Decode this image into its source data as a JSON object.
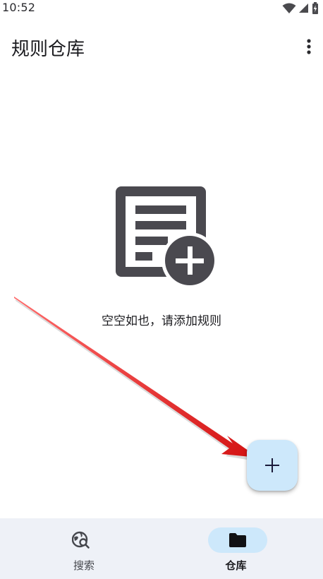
{
  "status_bar": {
    "time": "10:52",
    "icons": [
      "wifi-icon",
      "signal-icon",
      "battery-icon"
    ]
  },
  "app_bar": {
    "title": "规则仓库",
    "menu_icon": "more-vert-icon"
  },
  "empty_state": {
    "icon": "note-add-icon",
    "message": "空空如也，请添加规则"
  },
  "fab": {
    "icon": "add-icon"
  },
  "annotation": {
    "color": "#e01b1b"
  },
  "bottom_nav": {
    "items": [
      {
        "label": "搜索",
        "icon": "travel-explore-icon",
        "selected": false
      },
      {
        "label": "仓库",
        "icon": "folder-icon",
        "selected": true
      }
    ]
  },
  "colors": {
    "accent_container": "#cde8fb",
    "nav_background": "#eef1f7",
    "icon_dark": "#4a494f"
  }
}
